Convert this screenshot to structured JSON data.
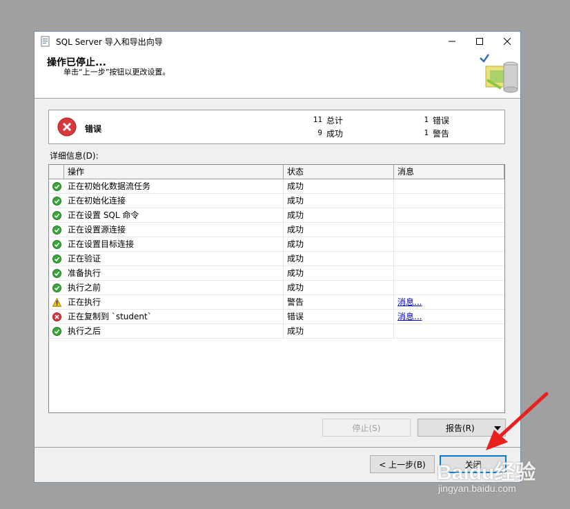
{
  "window": {
    "title": "SQL Server 导入和导出向导"
  },
  "header": {
    "title": "操作已停止...",
    "subtitle": "单击“上一步”按钮以更改设置。"
  },
  "summary": {
    "status": "错误",
    "total_count": "11",
    "total_label": "总计",
    "success_count": "9",
    "success_label": "成功",
    "error_count": "1",
    "error_label": "错误",
    "warning_count": "1",
    "warning_label": "警告"
  },
  "details": {
    "label": "详细信息(D):",
    "columns": [
      "操作",
      "状态",
      "消息"
    ],
    "rows": [
      {
        "icon": "success-icon",
        "action": "正在初始化数据流任务",
        "status": "成功",
        "message": ""
      },
      {
        "icon": "success-icon",
        "action": "正在初始化连接",
        "status": "成功",
        "message": ""
      },
      {
        "icon": "success-icon",
        "action": "正在设置 SQL 命令",
        "status": "成功",
        "message": ""
      },
      {
        "icon": "success-icon",
        "action": "正在设置源连接",
        "status": "成功",
        "message": ""
      },
      {
        "icon": "success-icon",
        "action": "正在设置目标连接",
        "status": "成功",
        "message": ""
      },
      {
        "icon": "success-icon",
        "action": "正在验证",
        "status": "成功",
        "message": ""
      },
      {
        "icon": "success-icon",
        "action": "准备执行",
        "status": "成功",
        "message": ""
      },
      {
        "icon": "success-icon",
        "action": "执行之前",
        "status": "成功",
        "message": ""
      },
      {
        "icon": "warning-icon",
        "action": "正在执行",
        "status": "警告",
        "message": "消息..."
      },
      {
        "icon": "error-icon",
        "action": "正在复制到 `student`",
        "status": "错误",
        "message": "消息..."
      },
      {
        "icon": "success-icon",
        "action": "执行之后",
        "status": "成功",
        "message": ""
      }
    ]
  },
  "buttons": {
    "stop": "停止(S)",
    "report": "报告(R)",
    "back": "< 上一步(B)",
    "close": "关闭"
  },
  "watermark": {
    "logo": "Baidu经验",
    "url": "jingyan.baidu.com"
  },
  "colors": {
    "success": "#3aa53a",
    "warning": "#f2c500",
    "error": "#d9383c",
    "accent": "#0078d7",
    "arrow": "#e8211e"
  }
}
